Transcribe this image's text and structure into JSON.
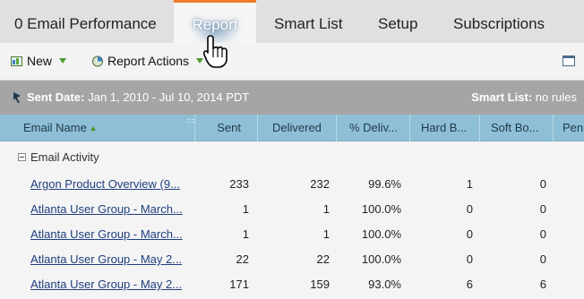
{
  "tabs": [
    {
      "label": "0 Email Performance",
      "active": false
    },
    {
      "label": "Report",
      "active": true
    },
    {
      "label": "Smart List",
      "active": false
    },
    {
      "label": "Setup",
      "active": false
    },
    {
      "label": "Subscriptions",
      "active": false
    }
  ],
  "toolbar": {
    "new_label": "New",
    "report_actions_label": "Report Actions"
  },
  "filter": {
    "sent_date_label": "Sent Date:",
    "sent_date_value": "Jan 1, 2010 - Jul 10, 2014 PDT",
    "smart_list_label": "Smart List:",
    "smart_list_value": "no rules"
  },
  "table": {
    "columns": [
      "Email Name",
      "Sent",
      "Delivered",
      "% Deliv...",
      "Hard B...",
      "Soft Bo...",
      "Pen"
    ],
    "group": "Email Activity",
    "rows": [
      {
        "name": "Argon Product Overview (9...",
        "sent": "233",
        "delivered": "232",
        "pct": "99.6%",
        "hard": "1",
        "soft": "0"
      },
      {
        "name": "Atlanta User Group - March...",
        "sent": "1",
        "delivered": "1",
        "pct": "100.0%",
        "hard": "0",
        "soft": "0"
      },
      {
        "name": "Atlanta User Group - March...",
        "sent": "1",
        "delivered": "1",
        "pct": "100.0%",
        "hard": "0",
        "soft": "0"
      },
      {
        "name": "Atlanta User Group - May 2...",
        "sent": "22",
        "delivered": "22",
        "pct": "100.0%",
        "hard": "0",
        "soft": "0"
      },
      {
        "name": "Atlanta User Group - May 2...",
        "sent": "171",
        "delivered": "159",
        "pct": "93.0%",
        "hard": "6",
        "soft": "6"
      }
    ]
  },
  "colors": {
    "accent": "#ef7b2a",
    "header_bg": "#8ebfd6",
    "filter_bg": "#a5a5a5",
    "link": "#1f3f80"
  }
}
